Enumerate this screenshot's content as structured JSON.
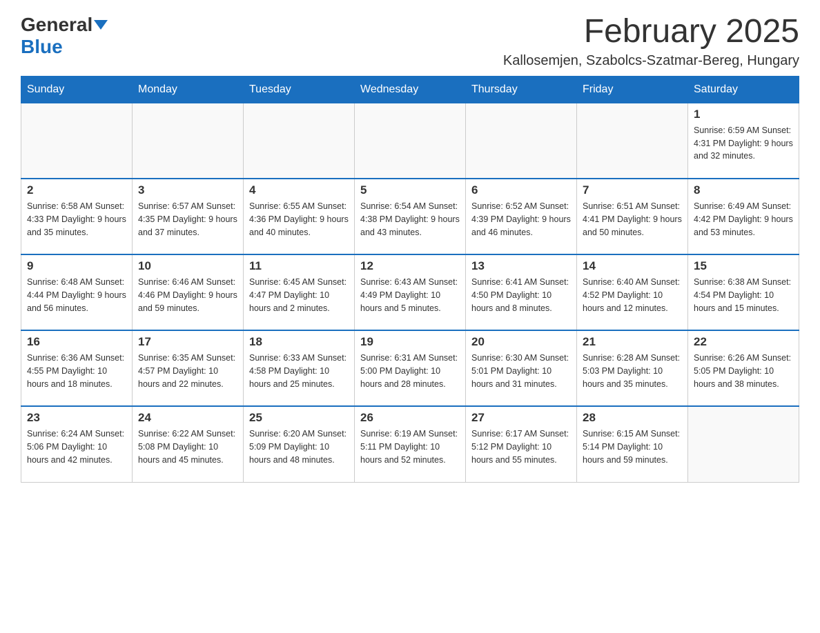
{
  "logo": {
    "general": "General",
    "blue": "Blue"
  },
  "header": {
    "month": "February 2025",
    "location": "Kallosemjen, Szabolcs-Szatmar-Bereg, Hungary"
  },
  "weekdays": [
    "Sunday",
    "Monday",
    "Tuesday",
    "Wednesday",
    "Thursday",
    "Friday",
    "Saturday"
  ],
  "weeks": [
    [
      {
        "day": "",
        "info": ""
      },
      {
        "day": "",
        "info": ""
      },
      {
        "day": "",
        "info": ""
      },
      {
        "day": "",
        "info": ""
      },
      {
        "day": "",
        "info": ""
      },
      {
        "day": "",
        "info": ""
      },
      {
        "day": "1",
        "info": "Sunrise: 6:59 AM\nSunset: 4:31 PM\nDaylight: 9 hours and 32 minutes."
      }
    ],
    [
      {
        "day": "2",
        "info": "Sunrise: 6:58 AM\nSunset: 4:33 PM\nDaylight: 9 hours and 35 minutes."
      },
      {
        "day": "3",
        "info": "Sunrise: 6:57 AM\nSunset: 4:35 PM\nDaylight: 9 hours and 37 minutes."
      },
      {
        "day": "4",
        "info": "Sunrise: 6:55 AM\nSunset: 4:36 PM\nDaylight: 9 hours and 40 minutes."
      },
      {
        "day": "5",
        "info": "Sunrise: 6:54 AM\nSunset: 4:38 PM\nDaylight: 9 hours and 43 minutes."
      },
      {
        "day": "6",
        "info": "Sunrise: 6:52 AM\nSunset: 4:39 PM\nDaylight: 9 hours and 46 minutes."
      },
      {
        "day": "7",
        "info": "Sunrise: 6:51 AM\nSunset: 4:41 PM\nDaylight: 9 hours and 50 minutes."
      },
      {
        "day": "8",
        "info": "Sunrise: 6:49 AM\nSunset: 4:42 PM\nDaylight: 9 hours and 53 minutes."
      }
    ],
    [
      {
        "day": "9",
        "info": "Sunrise: 6:48 AM\nSunset: 4:44 PM\nDaylight: 9 hours and 56 minutes."
      },
      {
        "day": "10",
        "info": "Sunrise: 6:46 AM\nSunset: 4:46 PM\nDaylight: 9 hours and 59 minutes."
      },
      {
        "day": "11",
        "info": "Sunrise: 6:45 AM\nSunset: 4:47 PM\nDaylight: 10 hours and 2 minutes."
      },
      {
        "day": "12",
        "info": "Sunrise: 6:43 AM\nSunset: 4:49 PM\nDaylight: 10 hours and 5 minutes."
      },
      {
        "day": "13",
        "info": "Sunrise: 6:41 AM\nSunset: 4:50 PM\nDaylight: 10 hours and 8 minutes."
      },
      {
        "day": "14",
        "info": "Sunrise: 6:40 AM\nSunset: 4:52 PM\nDaylight: 10 hours and 12 minutes."
      },
      {
        "day": "15",
        "info": "Sunrise: 6:38 AM\nSunset: 4:54 PM\nDaylight: 10 hours and 15 minutes."
      }
    ],
    [
      {
        "day": "16",
        "info": "Sunrise: 6:36 AM\nSunset: 4:55 PM\nDaylight: 10 hours and 18 minutes."
      },
      {
        "day": "17",
        "info": "Sunrise: 6:35 AM\nSunset: 4:57 PM\nDaylight: 10 hours and 22 minutes."
      },
      {
        "day": "18",
        "info": "Sunrise: 6:33 AM\nSunset: 4:58 PM\nDaylight: 10 hours and 25 minutes."
      },
      {
        "day": "19",
        "info": "Sunrise: 6:31 AM\nSunset: 5:00 PM\nDaylight: 10 hours and 28 minutes."
      },
      {
        "day": "20",
        "info": "Sunrise: 6:30 AM\nSunset: 5:01 PM\nDaylight: 10 hours and 31 minutes."
      },
      {
        "day": "21",
        "info": "Sunrise: 6:28 AM\nSunset: 5:03 PM\nDaylight: 10 hours and 35 minutes."
      },
      {
        "day": "22",
        "info": "Sunrise: 6:26 AM\nSunset: 5:05 PM\nDaylight: 10 hours and 38 minutes."
      }
    ],
    [
      {
        "day": "23",
        "info": "Sunrise: 6:24 AM\nSunset: 5:06 PM\nDaylight: 10 hours and 42 minutes."
      },
      {
        "day": "24",
        "info": "Sunrise: 6:22 AM\nSunset: 5:08 PM\nDaylight: 10 hours and 45 minutes."
      },
      {
        "day": "25",
        "info": "Sunrise: 6:20 AM\nSunset: 5:09 PM\nDaylight: 10 hours and 48 minutes."
      },
      {
        "day": "26",
        "info": "Sunrise: 6:19 AM\nSunset: 5:11 PM\nDaylight: 10 hours and 52 minutes."
      },
      {
        "day": "27",
        "info": "Sunrise: 6:17 AM\nSunset: 5:12 PM\nDaylight: 10 hours and 55 minutes."
      },
      {
        "day": "28",
        "info": "Sunrise: 6:15 AM\nSunset: 5:14 PM\nDaylight: 10 hours and 59 minutes."
      },
      {
        "day": "",
        "info": ""
      }
    ]
  ]
}
